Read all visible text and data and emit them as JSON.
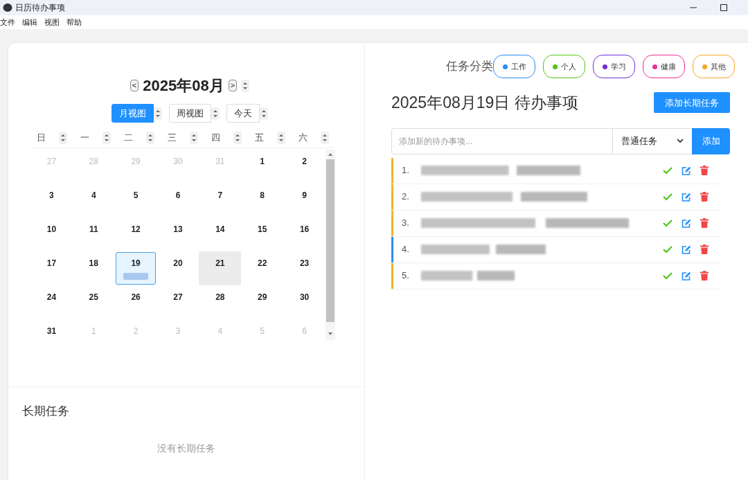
{
  "window": {
    "title": "日历待办事项"
  },
  "menu": [
    "文件",
    "编辑",
    "视图",
    "帮助"
  ],
  "calendar": {
    "prev": "<",
    "month_label": "2025年08月",
    "next": ">",
    "views": [
      {
        "label": "月视图",
        "selected": true
      },
      {
        "label": "周视图",
        "selected": false
      },
      {
        "label": "今天",
        "selected": false
      }
    ],
    "weekdays": [
      "日",
      "一",
      "二",
      "三",
      "四",
      "五",
      "六"
    ],
    "weeks": [
      [
        {
          "day": "27",
          "other_month": true,
          "selected": false,
          "shaded": false,
          "has_event": false
        },
        {
          "day": "28",
          "other_month": true,
          "selected": false,
          "shaded": false,
          "has_event": false
        },
        {
          "day": "29",
          "other_month": true,
          "selected": false,
          "shaded": false,
          "has_event": false
        },
        {
          "day": "30",
          "other_month": true,
          "selected": false,
          "shaded": false,
          "has_event": false
        },
        {
          "day": "31",
          "other_month": true,
          "selected": false,
          "shaded": false,
          "has_event": false
        },
        {
          "day": "1",
          "other_month": false,
          "selected": false,
          "shaded": false,
          "has_event": false
        },
        {
          "day": "2",
          "other_month": false,
          "selected": false,
          "shaded": false,
          "has_event": false
        }
      ],
      [
        {
          "day": "3",
          "other_month": false,
          "selected": false,
          "shaded": false,
          "has_event": false
        },
        {
          "day": "4",
          "other_month": false,
          "selected": false,
          "shaded": false,
          "has_event": false
        },
        {
          "day": "5",
          "other_month": false,
          "selected": false,
          "shaded": false,
          "has_event": false
        },
        {
          "day": "6",
          "other_month": false,
          "selected": false,
          "shaded": false,
          "has_event": false
        },
        {
          "day": "7",
          "other_month": false,
          "selected": false,
          "shaded": false,
          "has_event": false
        },
        {
          "day": "8",
          "other_month": false,
          "selected": false,
          "shaded": false,
          "has_event": false
        },
        {
          "day": "9",
          "other_month": false,
          "selected": false,
          "shaded": false,
          "has_event": false
        }
      ],
      [
        {
          "day": "10",
          "other_month": false,
          "selected": false,
          "shaded": false,
          "has_event": false
        },
        {
          "day": "11",
          "other_month": false,
          "selected": false,
          "shaded": false,
          "has_event": false
        },
        {
          "day": "12",
          "other_month": false,
          "selected": false,
          "shaded": false,
          "has_event": false
        },
        {
          "day": "13",
          "other_month": false,
          "selected": false,
          "shaded": false,
          "has_event": false
        },
        {
          "day": "14",
          "other_month": false,
          "selected": false,
          "shaded": false,
          "has_event": false
        },
        {
          "day": "15",
          "other_month": false,
          "selected": false,
          "shaded": false,
          "has_event": false
        },
        {
          "day": "16",
          "other_month": false,
          "selected": false,
          "shaded": false,
          "has_event": false
        }
      ],
      [
        {
          "day": "17",
          "other_month": false,
          "selected": false,
          "shaded": false,
          "has_event": false
        },
        {
          "day": "18",
          "other_month": false,
          "selected": false,
          "shaded": false,
          "has_event": false
        },
        {
          "day": "19",
          "other_month": false,
          "selected": true,
          "shaded": false,
          "has_event": true
        },
        {
          "day": "20",
          "other_month": false,
          "selected": false,
          "shaded": false,
          "has_event": false
        },
        {
          "day": "21",
          "other_month": false,
          "selected": false,
          "shaded": true,
          "has_event": false
        },
        {
          "day": "22",
          "other_month": false,
          "selected": false,
          "shaded": false,
          "has_event": false
        },
        {
          "day": "23",
          "other_month": false,
          "selected": false,
          "shaded": false,
          "has_event": false
        }
      ],
      [
        {
          "day": "24",
          "other_month": false,
          "selected": false,
          "shaded": false,
          "has_event": false
        },
        {
          "day": "25",
          "other_month": false,
          "selected": false,
          "shaded": false,
          "has_event": false
        },
        {
          "day": "26",
          "other_month": false,
          "selected": false,
          "shaded": false,
          "has_event": false
        },
        {
          "day": "27",
          "other_month": false,
          "selected": false,
          "shaded": false,
          "has_event": false
        },
        {
          "day": "28",
          "other_month": false,
          "selected": false,
          "shaded": false,
          "has_event": false
        },
        {
          "day": "29",
          "other_month": false,
          "selected": false,
          "shaded": false,
          "has_event": false
        },
        {
          "day": "30",
          "other_month": false,
          "selected": false,
          "shaded": false,
          "has_event": false
        }
      ],
      [
        {
          "day": "31",
          "other_month": false,
          "selected": false,
          "shaded": false,
          "has_event": false
        },
        {
          "day": "1",
          "other_month": true,
          "selected": false,
          "shaded": false,
          "has_event": false
        },
        {
          "day": "2",
          "other_month": true,
          "selected": false,
          "shaded": false,
          "has_event": false
        },
        {
          "day": "3",
          "other_month": true,
          "selected": false,
          "shaded": false,
          "has_event": false
        },
        {
          "day": "4",
          "other_month": true,
          "selected": false,
          "shaded": false,
          "has_event": false
        },
        {
          "day": "5",
          "other_month": true,
          "selected": false,
          "shaded": false,
          "has_event": false
        },
        {
          "day": "6",
          "other_month": true,
          "selected": false,
          "shaded": false,
          "has_event": false
        }
      ]
    ]
  },
  "long_term": {
    "title": "长期任务",
    "empty_text": "没有长期任务"
  },
  "categories": {
    "label": "任务分类",
    "items": [
      {
        "label": "工作",
        "color": "#2d8cf0"
      },
      {
        "label": "个人",
        "color": "#52c41a"
      },
      {
        "label": "学习",
        "color": "#722ed1"
      },
      {
        "label": "健康",
        "color": "#eb2f96"
      },
      {
        "label": "其他",
        "color": "#f5a623"
      }
    ]
  },
  "todo": {
    "heading": "2025年08月19日 待办事项",
    "add_long_button": "添加长期任务",
    "placeholder": "添加新的待办事项...",
    "type_select": "普通任务",
    "add_button": "添加",
    "tasks": [
      {
        "number": "1.",
        "color": "#f0b429"
      },
      {
        "number": "2.",
        "color": "#f0b429"
      },
      {
        "number": "3.",
        "color": "#f0b429"
      },
      {
        "number": "4.",
        "color": "#2d8cf0"
      },
      {
        "number": "5.",
        "color": "#f0b429"
      }
    ]
  }
}
